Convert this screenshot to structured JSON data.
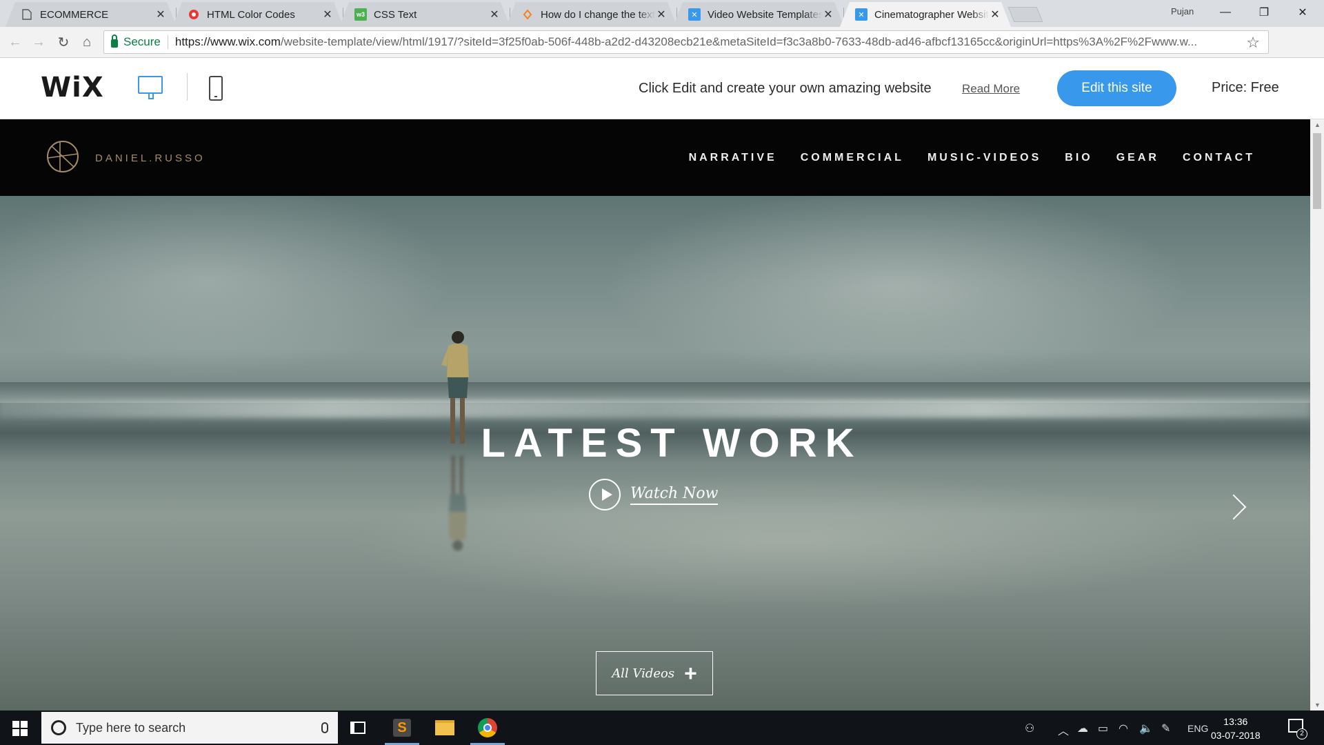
{
  "browser": {
    "tabs": [
      {
        "title": "ECOMMERCE",
        "favicon": "document-icon"
      },
      {
        "title": "HTML Color Codes",
        "favicon": "color-codes-icon"
      },
      {
        "title": "CSS Text",
        "favicon": "w3schools-icon"
      },
      {
        "title": "How do I change the text",
        "favicon": "stackoverflow-icon"
      },
      {
        "title": "Video Website Templates",
        "favicon": "wix-icon"
      },
      {
        "title": "Cinematographer Website",
        "favicon": "wix-icon"
      }
    ],
    "active_tab": 5,
    "profile_name": "Pujan",
    "secure_label": "Secure",
    "url_host": "https://www.wix.com",
    "url_path": "/website-template/view/html/1917/?siteId=3f25f0ab-506f-448b-a2d2-d43208ecb21e&metaSiteId=f3c3a8b0-7633-48db-ad46-afbcf13165cc&originUrl=https%3A%2F%2Fwww.w..."
  },
  "wix_bar": {
    "logo": "WiX",
    "promo_text": "Click Edit and create your own amazing website",
    "read_more": "Read More",
    "edit_button": "Edit this site",
    "price": "Price: Free",
    "accent_color": "#3899ec"
  },
  "site": {
    "brand": "DANIEL.RUSSO",
    "menu": [
      "NARRATIVE",
      "COMMERCIAL",
      "MUSIC-VIDEOS",
      "BIO",
      "GEAR",
      "CONTACT"
    ],
    "hero_title": "LATEST WORK",
    "watch_label": "Watch Now",
    "all_videos_label": "All Videos",
    "brand_color": "#a58d68"
  },
  "taskbar": {
    "search_placeholder": "Type here to search",
    "language": "ENG",
    "time": "13:36",
    "date": "03-07-2018",
    "notification_count": "2"
  }
}
